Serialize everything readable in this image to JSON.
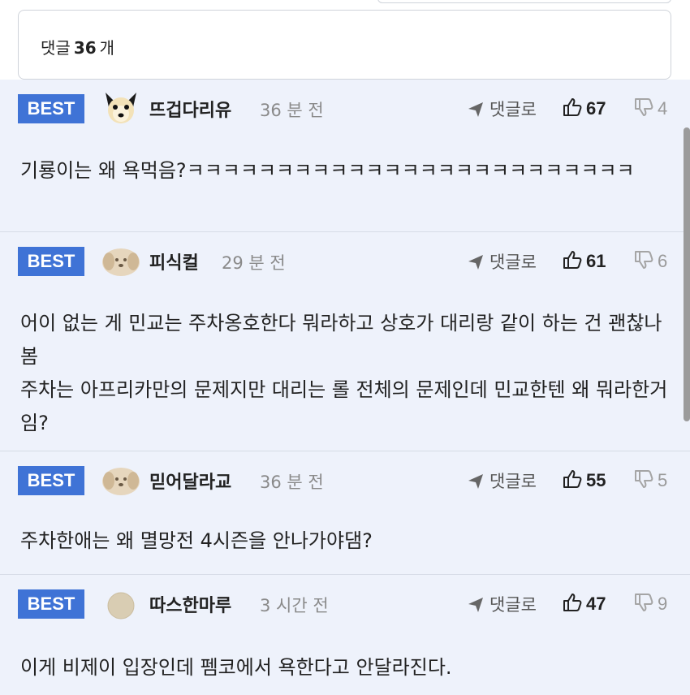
{
  "comment_count": {
    "prefix": "댓글",
    "count": "36",
    "suffix": "개"
  },
  "badge_label": "BEST",
  "reply_label": "댓글로",
  "colors": {
    "badge": "#3f73d6",
    "background": "#eef2fb"
  },
  "comments": [
    {
      "nickname": "뜨겁다리유",
      "time": "36 분 전",
      "likes": "67",
      "dislikes": "4",
      "avatar": "dog-avatar",
      "body": "기룡이는 왜 욕먹음?ㅋㅋㅋㅋㅋㅋㅋㅋㅋㅋㅋㅋㅋㅋㅋㅋㅋㅋㅋㅋㅋㅋㅋㅋㅋ"
    },
    {
      "nickname": "피식컬",
      "time": "29 분 전",
      "likes": "61",
      "dislikes": "6",
      "avatar": "puppy-avatar",
      "body": "어이 없는 게 민교는 주차옹호한다 뭐라하고 상호가 대리랑 같이 하는 건 괜찮나봄\n주차는 아프리카만의 문제지만 대리는 롤 전체의 문제인데 민교한텐 왜 뭐라한거임?"
    },
    {
      "nickname": "믿어달라교",
      "time": "36 분 전",
      "likes": "55",
      "dislikes": "5",
      "avatar": "puppy-avatar",
      "body": "주차한애는 왜 멸망전 4시즌을 안나가야댐?"
    },
    {
      "nickname": "따스한마루",
      "time": "3 시간 전",
      "likes": "47",
      "dislikes": "9",
      "avatar": "round-avatar",
      "body": "이게 비제이 입장인데 펨코에서 욕한다고 안달라진다."
    }
  ]
}
